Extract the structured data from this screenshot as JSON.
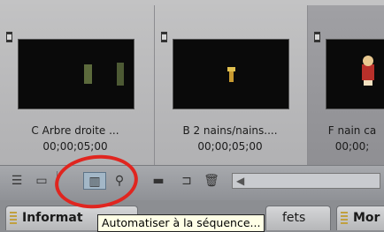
{
  "clips": [
    {
      "name": "C Arbre droite ...",
      "duration": "00;00;05;00"
    },
    {
      "name": "B 2 nains/nains....",
      "duration": "00;00;05;00"
    },
    {
      "name": "F nain ca",
      "duration": "00;00;"
    }
  ],
  "toolbar": {
    "buttons": [
      {
        "id": "list-view",
        "glyph": "☰"
      },
      {
        "id": "icon-view",
        "glyph": "▭"
      },
      {
        "id": "automate-to-sequence",
        "glyph": "▥"
      },
      {
        "id": "find",
        "glyph": "⚲"
      },
      {
        "id": "new-bin",
        "glyph": "▬"
      },
      {
        "id": "new-item",
        "glyph": "⊐"
      },
      {
        "id": "delete",
        "glyph": "🗑"
      },
      {
        "id": "scroll-left",
        "glyph": "◀"
      }
    ]
  },
  "tabs": [
    {
      "label": "Informat"
    },
    {
      "label": "fets"
    },
    {
      "label": "Mor"
    }
  ],
  "tooltip": {
    "text": "Automatiser à la séquence..."
  },
  "colors": {
    "highlight": "#e0251f",
    "tooltip_bg": "#ffffe6"
  }
}
